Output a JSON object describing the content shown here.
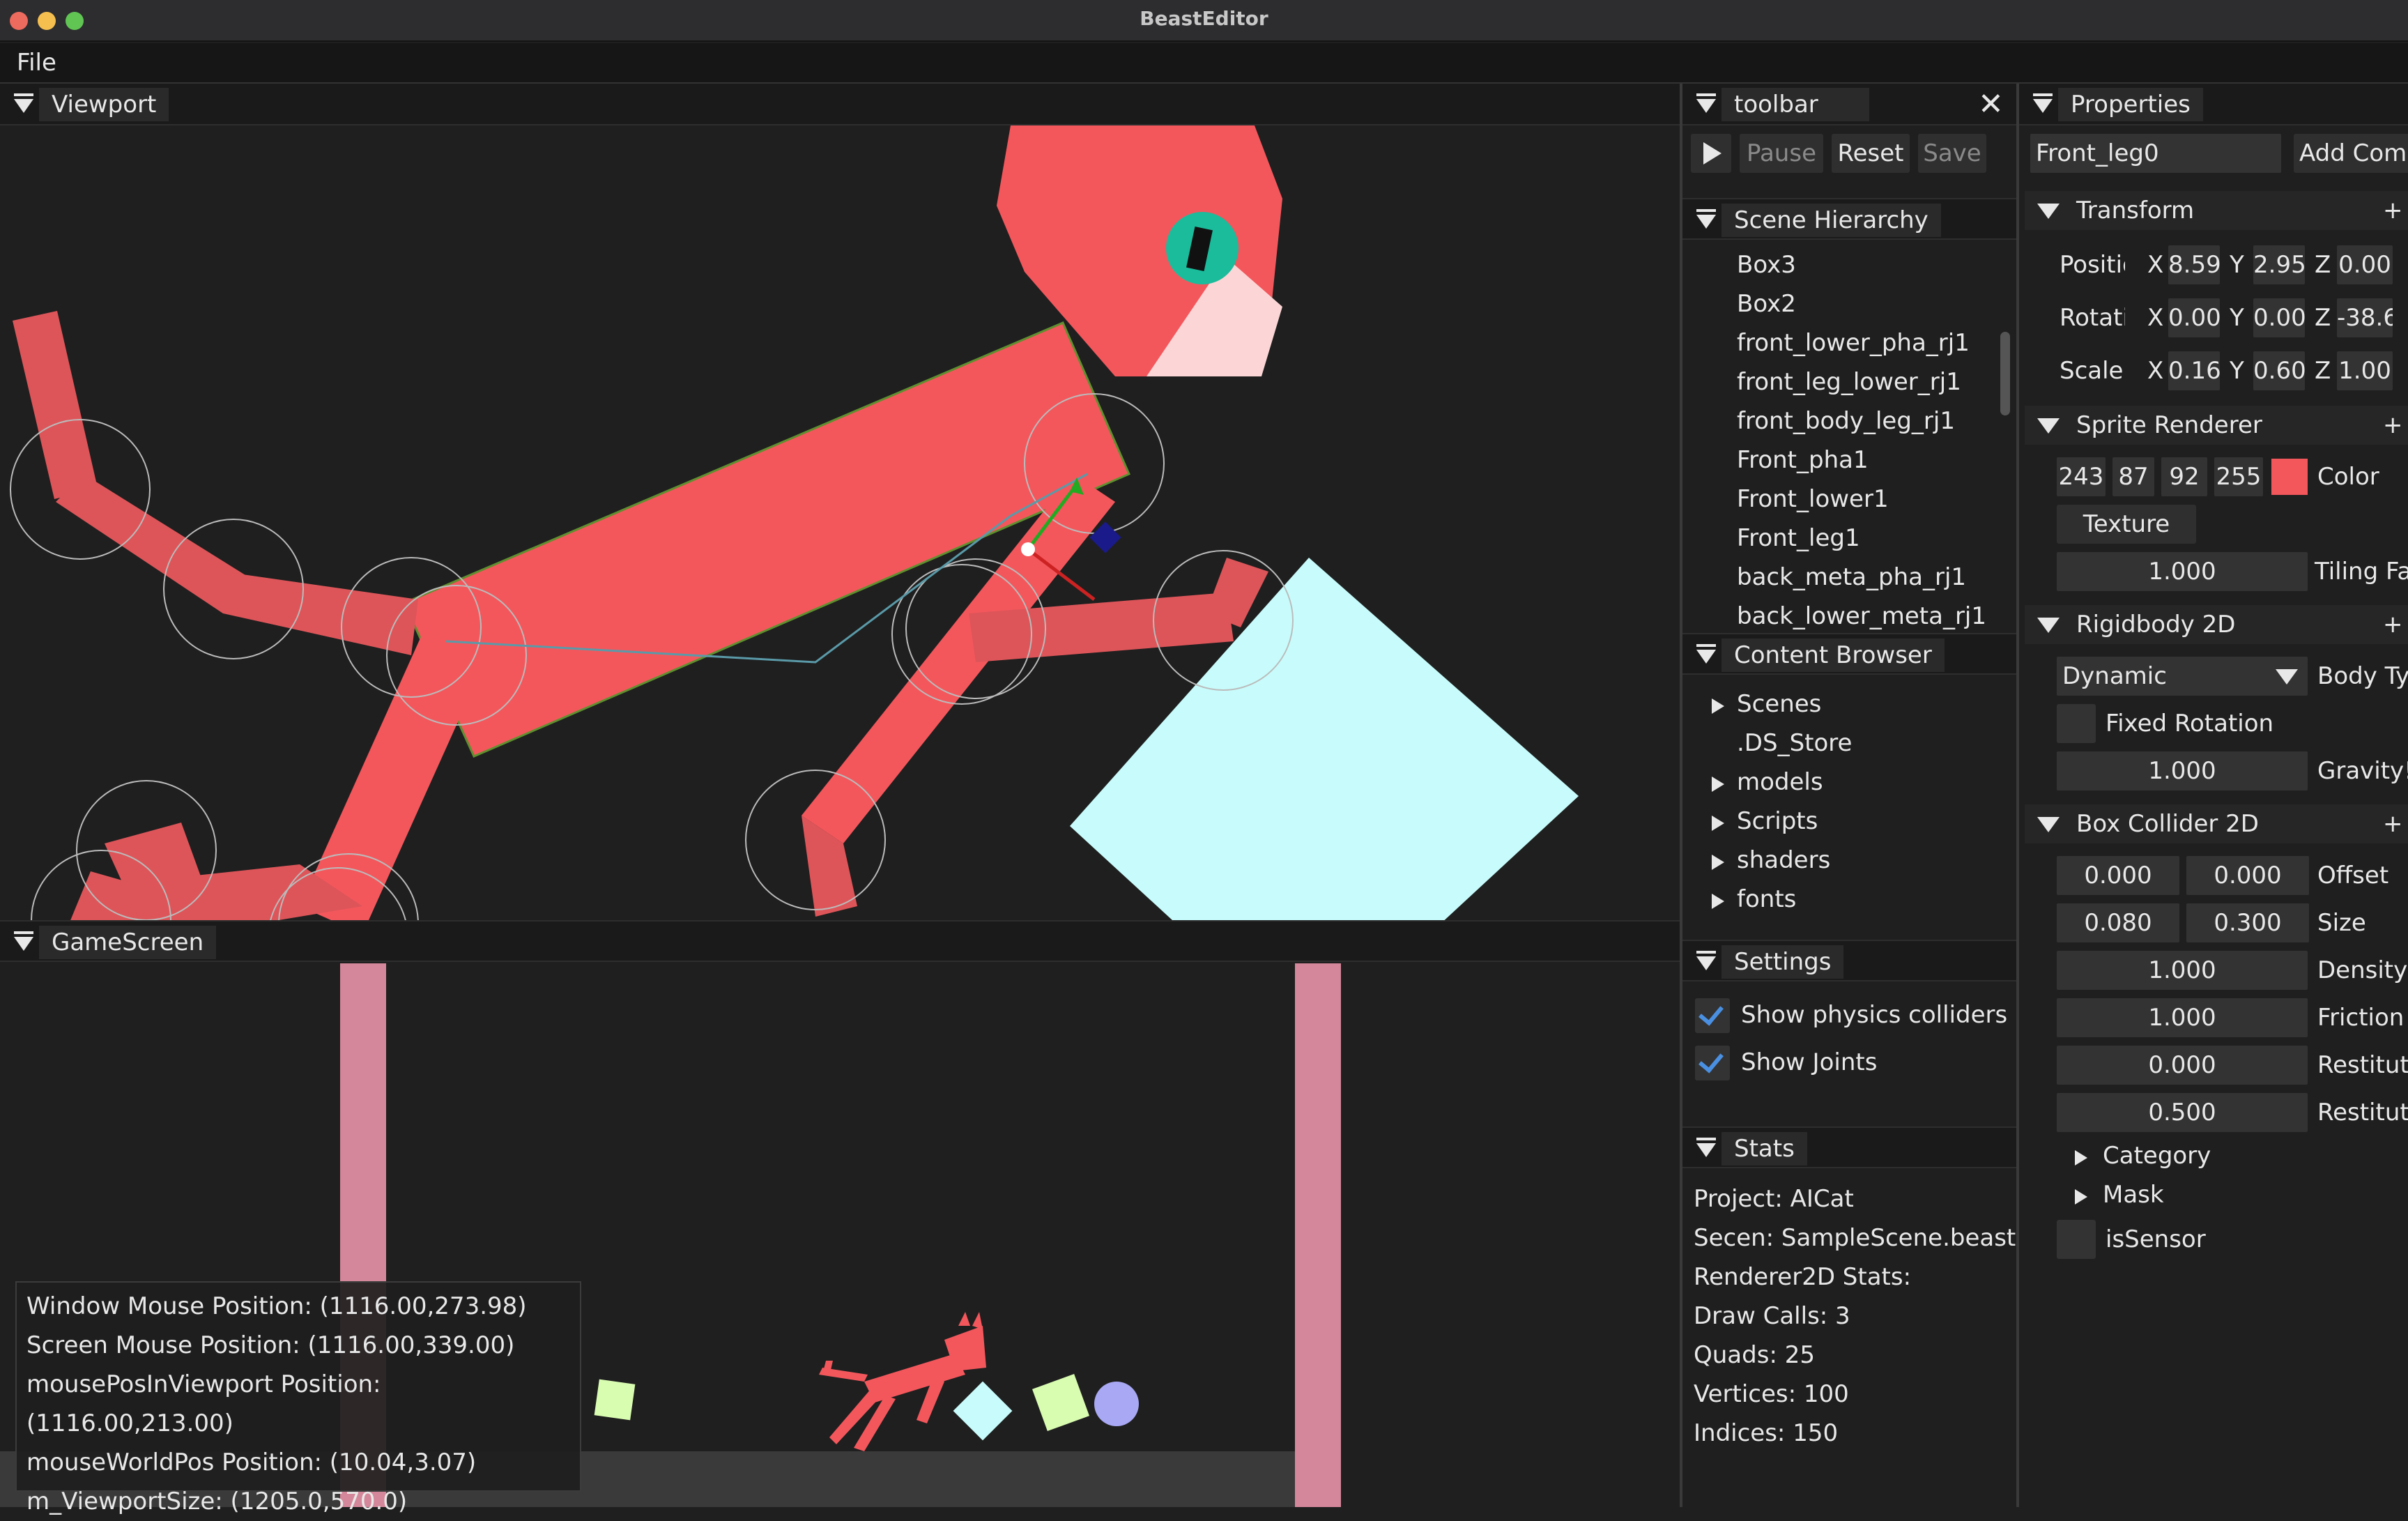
{
  "window": {
    "title": "BeastEditor"
  },
  "menu": {
    "file": "File"
  },
  "viewport": {
    "tab": "Viewport"
  },
  "gamescreen": {
    "tab": "GameScreen",
    "overlay": [
      "Window Mouse Position: (1116.00,273.98)",
      "Screen Mouse Position: (1116.00,339.00)",
      "mousePosInViewport Position: (1116.00,213.00)",
      "mouseWorldPos Position: (10.04,3.07)",
      "m_ViewportSize: (1205.0,570.0)"
    ]
  },
  "toolbar": {
    "tab": "toolbar",
    "pause": "Pause",
    "reset": "Reset",
    "save": "Save"
  },
  "hierarchy": {
    "tab": "Scene Hierarchy",
    "items": [
      "Box3",
      "Box2",
      "front_lower_pha_rj1",
      "front_leg_lower_rj1",
      "front_body_leg_rj1",
      "Front_pha1",
      "Front_lower1",
      "Front_leg1",
      "back_meta_pha_rj1",
      "back_lower_meta_rj1"
    ]
  },
  "content": {
    "tab": "Content Browser",
    "items": [
      {
        "label": "Scenes",
        "folder": true
      },
      {
        "label": ".DS_Store",
        "folder": false
      },
      {
        "label": "models",
        "folder": true
      },
      {
        "label": "Scripts",
        "folder": true
      },
      {
        "label": "shaders",
        "folder": true
      },
      {
        "label": "fonts",
        "folder": true
      }
    ]
  },
  "settings": {
    "tab": "Settings",
    "colliders": "Show physics colliders",
    "joints": "Show Joints"
  },
  "stats": {
    "tab": "Stats",
    "lines": [
      "Project: AICat",
      "Secen: SampleScene.beast",
      "Renderer2D Stats:",
      "Draw Calls: 3",
      "Quads: 25",
      "Vertices: 100",
      "Indices: 150"
    ]
  },
  "properties": {
    "tab": "Properties",
    "name": "Front_leg0",
    "add": "Add Com",
    "transform": {
      "title": "Transform",
      "position_label": "Positio",
      "rotation_label": "Rotatio",
      "scale_label": "Scale",
      "pos": [
        "8.59",
        "2.95",
        "0.00"
      ],
      "rot": [
        "0.00",
        "0.00",
        "-38.6"
      ],
      "scale": [
        "0.16",
        "0.60",
        "1.00"
      ],
      "x": "X",
      "y": "Y",
      "z": "Z"
    },
    "sprite": {
      "title": "Sprite Renderer",
      "rgba": [
        "243",
        "87",
        "92",
        "255"
      ],
      "color_label": "Color",
      "swatch": "#f3575c",
      "texture": "Texture",
      "tiling": "1.000",
      "tiling_label": "Tiling Fa"
    },
    "rigidbody": {
      "title": "Rigidbody 2D",
      "type": "Dynamic",
      "type_label": "Body Ty",
      "fixed_rotation": "Fixed Rotation",
      "gravity": "1.000",
      "gravity_label": "Gravity!"
    },
    "collider": {
      "title": "Box Collider 2D",
      "offset": [
        "0.000",
        "0.000"
      ],
      "offset_label": "Offset",
      "size": [
        "0.080",
        "0.300"
      ],
      "size_label": "Size",
      "density": "1.000",
      "density_label": "Density",
      "friction": "1.000",
      "friction_label": "Friction",
      "restitution": "0.000",
      "restitution_label": "Restitut",
      "restitution2": "0.500",
      "restitution2_label": "Restitut",
      "category": "Category",
      "mask": "Mask",
      "sensor": "isSensor"
    },
    "plus": "+"
  },
  "colors": {
    "cat": "#f3575c",
    "box": "#c8fcfc",
    "pillar": "#d4879a"
  }
}
